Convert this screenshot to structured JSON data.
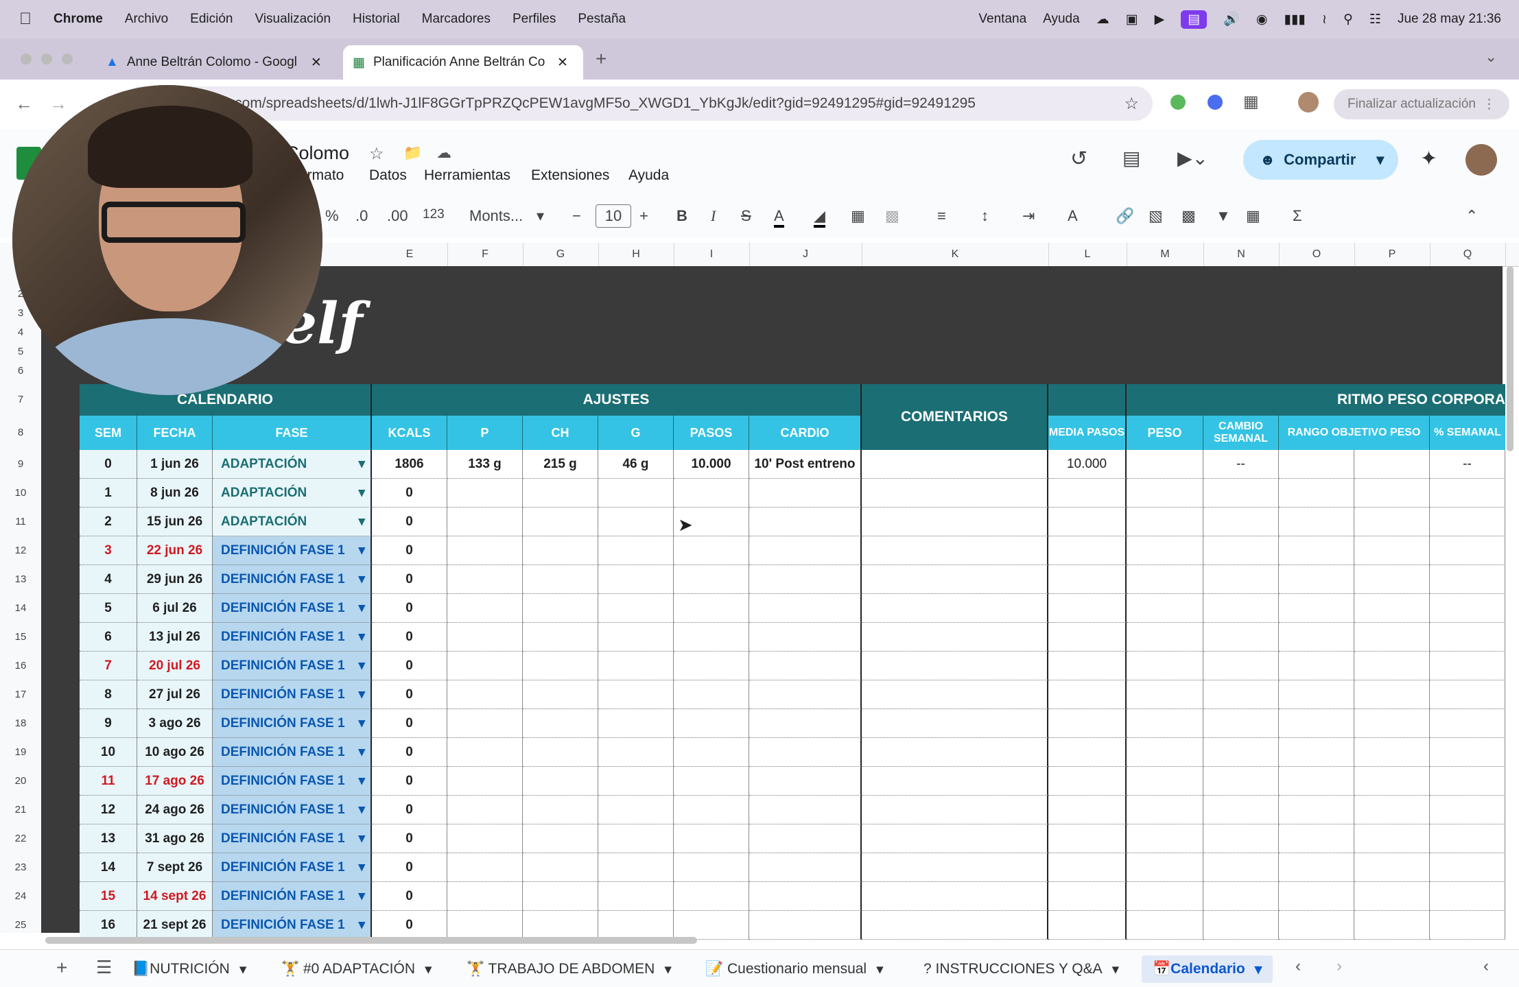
{
  "menubar": {
    "app": "Chrome",
    "items": [
      "Archivo",
      "Edición",
      "Visualización",
      "Historial",
      "Marcadores",
      "Perfiles",
      "Pestaña"
    ],
    "right_items": [
      "Ventana",
      "Ayuda"
    ],
    "clock": "Jue 28 may 21:36"
  },
  "tabs": [
    {
      "title": "Anne Beltrán Colomo - Googl",
      "active": false
    },
    {
      "title": "Planificación Anne Beltrán Co",
      "active": true
    }
  ],
  "address": {
    "url": "le.com/spreadsheets/d/1lwh-J1lF8GGrTpPRZQcPEW1avgMF5o_XWGD1_YbKgJk/edit?gid=92491295#gid=92491295",
    "update_button": "Finalizar actualización"
  },
  "sheets": {
    "doc_title_fragment": "Colomo",
    "menu": [
      "ormato",
      "Datos",
      "Herramientas",
      "Extensiones",
      "Ayuda"
    ],
    "share": "Compartir",
    "font": "Monts...",
    "font_size": "10",
    "format_123": "123",
    "percent": "%",
    "dec_minus": ".0",
    "dec_plus": ".00"
  },
  "columns": [
    "E",
    "F",
    "G",
    "H",
    "I",
    "J",
    "K",
    "L",
    "M",
    "N",
    "O",
    "P",
    "Q"
  ],
  "logo_text": "elf",
  "headers": {
    "calendario": "CALENDARIO",
    "ajustes": "AJUSTES",
    "comentarios": "COMENTARIOS",
    "ritmo": "RITMO PESO CORPORA",
    "sem": "SEM",
    "fecha": "FECHA",
    "fase": "FASE",
    "kcals": "KCALS",
    "p": "P",
    "ch": "CH",
    "g": "G",
    "pasos": "PASOS",
    "cardio": "CARDIO",
    "media_pasos": "MEDIA PASOS",
    "peso": "PESO",
    "cambio_semanal": "CAMBIO SEMANAL",
    "rango": "RANGO OBJETIVO PESO",
    "pct_semanal": "% SEMANAL"
  },
  "rows": [
    {
      "row": "9",
      "sem": "0",
      "fecha": "1 jun 26",
      "fase": "ADAPTACIÓN",
      "kcals": "1806",
      "p": "133 g",
      "ch": "215 g",
      "g": "46 g",
      "pasos": "10.000",
      "cardio": "10' Post entreno",
      "media": "10.000",
      "cambio": "--",
      "pct": "--",
      "red": false
    },
    {
      "row": "10",
      "sem": "1",
      "fecha": "8 jun 26",
      "fase": "ADAPTACIÓN",
      "kcals": "0",
      "red": false
    },
    {
      "row": "11",
      "sem": "2",
      "fecha": "15 jun 26",
      "fase": "ADAPTACIÓN",
      "kcals": "0",
      "red": false
    },
    {
      "row": "12",
      "sem": "3",
      "fecha": "22 jun 26",
      "fase": "DEFINICIÓN FASE 1",
      "kcals": "0",
      "red": true
    },
    {
      "row": "13",
      "sem": "4",
      "fecha": "29 jun 26",
      "fase": "DEFINICIÓN FASE 1",
      "kcals": "0",
      "red": false
    },
    {
      "row": "14",
      "sem": "5",
      "fecha": "6 jul 26",
      "fase": "DEFINICIÓN FASE 1",
      "kcals": "0",
      "red": false
    },
    {
      "row": "15",
      "sem": "6",
      "fecha": "13 jul 26",
      "fase": "DEFINICIÓN FASE 1",
      "kcals": "0",
      "red": false
    },
    {
      "row": "16",
      "sem": "7",
      "fecha": "20 jul 26",
      "fase": "DEFINICIÓN FASE 1",
      "kcals": "0",
      "red": true
    },
    {
      "row": "17",
      "sem": "8",
      "fecha": "27 jul 26",
      "fase": "DEFINICIÓN FASE 1",
      "kcals": "0",
      "red": false
    },
    {
      "row": "18",
      "sem": "9",
      "fecha": "3 ago 26",
      "fase": "DEFINICIÓN FASE 1",
      "kcals": "0",
      "red": false
    },
    {
      "row": "19",
      "sem": "10",
      "fecha": "10 ago 26",
      "fase": "DEFINICIÓN FASE 1",
      "kcals": "0",
      "red": false
    },
    {
      "row": "20",
      "sem": "11",
      "fecha": "17 ago 26",
      "fase": "DEFINICIÓN FASE 1",
      "kcals": "0",
      "red": true
    },
    {
      "row": "21",
      "sem": "12",
      "fecha": "24 ago 26",
      "fase": "DEFINICIÓN FASE 1",
      "kcals": "0",
      "red": false
    },
    {
      "row": "22",
      "sem": "13",
      "fecha": "31 ago 26",
      "fase": "DEFINICIÓN FASE 1",
      "kcals": "0",
      "red": false
    },
    {
      "row": "23",
      "sem": "14",
      "fecha": "7 sept 26",
      "fase": "DEFINICIÓN FASE 1",
      "kcals": "0",
      "red": false
    },
    {
      "row": "24",
      "sem": "15",
      "fecha": "14 sept 26",
      "fase": "DEFINICIÓN FASE 1",
      "kcals": "0",
      "red": true
    },
    {
      "row": "25",
      "sem": "16",
      "fecha": "21 sept 26",
      "fase": "DEFINICIÓN FASE 1",
      "kcals": "0",
      "red": false
    }
  ],
  "top_row_numbers": [
    "2",
    "3",
    "4",
    "5",
    "6",
    "7",
    "8"
  ],
  "sheet_tabs": [
    "📘NUTRICIÓN",
    "🏋 #0 ADAPTACIÓN",
    "🏋 TRABAJO DE ABDOMEN",
    "📝 Cuestionario mensual",
    "? INSTRUCCIONES Y Q&A",
    "📅Calendario"
  ],
  "colors": {
    "teal_header": "#1b6e73",
    "cyan_header": "#34c3e4",
    "row_light": "#e8f6fa",
    "fase_definicion": "#b6d7ee",
    "red_week": "#d0181f",
    "dark_bg": "#3a3a3a",
    "accent_purple": "#7e3bed"
  }
}
